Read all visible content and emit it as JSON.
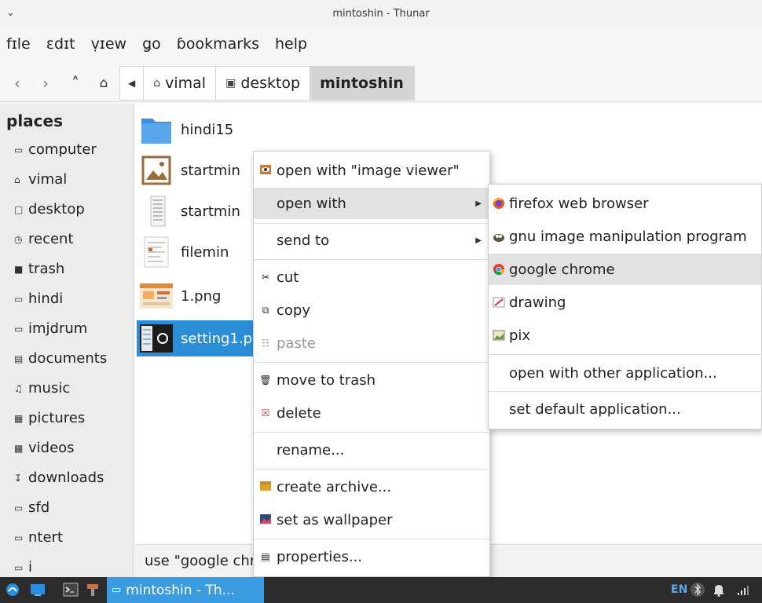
{
  "window": {
    "title": "mintoshin - Thunar",
    "menubar": [
      "fɪle",
      "ɛdɪt",
      "ṿɪew",
      "ǥo",
      "ɓookmarks",
      "help"
    ]
  },
  "pathbar": {
    "crumbs": [
      "vimal",
      "desktop",
      "mintoshin"
    ],
    "active_index": 2
  },
  "sidebar": {
    "heading": "places",
    "items": [
      {
        "label": "computer",
        "icon": "computer-icon"
      },
      {
        "label": "vimal",
        "icon": "home-icon"
      },
      {
        "label": "desktop",
        "icon": "desktop-icon"
      },
      {
        "label": "recent",
        "icon": "recent-icon"
      },
      {
        "label": "trash",
        "icon": "trash-icon"
      },
      {
        "label": "hindi",
        "icon": "folder-icon"
      },
      {
        "label": "imjdrum",
        "icon": "folder-icon"
      },
      {
        "label": "documents",
        "icon": "documents-icon"
      },
      {
        "label": "music",
        "icon": "music-icon"
      },
      {
        "label": "pictures",
        "icon": "pictures-icon"
      },
      {
        "label": "videos",
        "icon": "videos-icon"
      },
      {
        "label": "downloads",
        "icon": "downloads-icon"
      },
      {
        "label": "sfd",
        "icon": "folder-icon"
      },
      {
        "label": "ntert",
        "icon": "folder-icon"
      },
      {
        "label": "i",
        "icon": "folder-icon"
      }
    ]
  },
  "files": [
    {
      "name": "hindi15",
      "type": "folder"
    },
    {
      "name": "startmin",
      "type": "image"
    },
    {
      "name": "startmin",
      "type": "screenshot"
    },
    {
      "name": "filemin",
      "type": "document"
    },
    {
      "name": "1.png",
      "type": "image"
    },
    {
      "name": "setting1.p",
      "type": "image",
      "selected": true
    }
  ],
  "status": {
    "text": "use \"google chrome\" to open the selected file"
  },
  "context_menu": {
    "items": [
      {
        "label": "open with \"image viewer\"",
        "icon": "image-viewer-icon"
      },
      {
        "label": "open with",
        "submenu": true,
        "highlighted": true
      },
      {
        "label": "send to",
        "submenu": true
      },
      {
        "label": "cut",
        "icon": "scissors-icon"
      },
      {
        "label": "copy",
        "icon": "copy-icon"
      },
      {
        "label": "paste",
        "icon": "paste-icon",
        "disabled": true
      },
      {
        "label": "move to trash",
        "icon": "trash-icon"
      },
      {
        "label": "delete",
        "icon": "delete-icon"
      },
      {
        "label": "rename..."
      },
      {
        "label": "create archive...",
        "icon": "archive-icon"
      },
      {
        "label": "set as wallpaper",
        "icon": "wallpaper-icon"
      },
      {
        "label": "properties...",
        "icon": "properties-icon"
      }
    ]
  },
  "open_with_submenu": {
    "items": [
      {
        "label": "firefox web browser",
        "icon": "firefox-icon"
      },
      {
        "label": "gnu image manipulation program",
        "icon": "gimp-icon"
      },
      {
        "label": "google chrome",
        "icon": "chrome-icon",
        "highlighted": true
      },
      {
        "label": "drawing",
        "icon": "drawing-icon"
      },
      {
        "label": "pix",
        "icon": "pix-icon"
      },
      {
        "label": "open with other application..."
      },
      {
        "label": "set default application..."
      }
    ]
  },
  "taskbar": {
    "task_label": "mintoshin - Th...",
    "lang": "EN"
  },
  "colors": {
    "selection": "#2c8ed6",
    "folder": "#4a90d9",
    "taskbar": "#2b2b2b",
    "task_active": "#3a9be0"
  }
}
